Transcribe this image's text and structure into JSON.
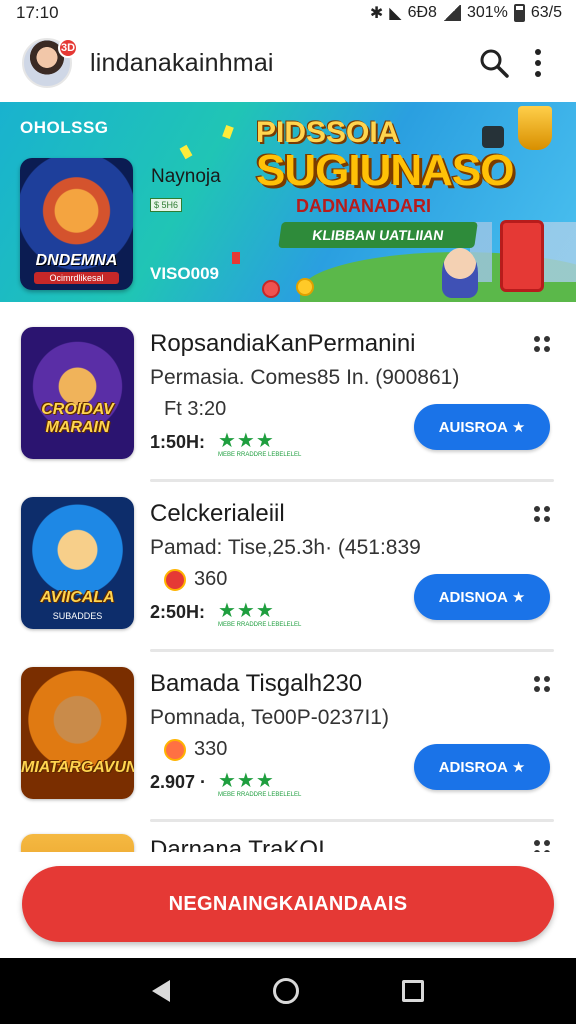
{
  "status_bar": {
    "time": "17:10",
    "network": "6Ð8",
    "battery_pct": "301%",
    "clock2": "63/5"
  },
  "header": {
    "avatar_badge": "3D",
    "title": "lindanakainhmai"
  },
  "banner": {
    "label": "OHOLSSG",
    "app_name": "Naynoja",
    "tag": "$ 5H6",
    "thumb_caption": "DNDEMNA",
    "thumb_sub": "Ocimrdlikesal",
    "code": "VISO009",
    "promo_title_line1": "PIDSSOIA",
    "promo_title_line2": "SUGIUNASO",
    "promo_subtitle": "DADNANADARI",
    "promo_ribbon": "KLIBBAN UATLIIAN"
  },
  "games": [
    {
      "title": "RopsandiaKanPermanini",
      "subtitle": "Permasia. Comes85 In. (900861)",
      "meta": "Ft 3:20",
      "time": "1:50H:",
      "stars": "★★★",
      "tiny": "MEBE RRADDRE LEBELELEL",
      "action_label": "AUISROA",
      "thumb_caption": "CROIDAV MARAIN",
      "thumb_caption2": ""
    },
    {
      "title": "Celckerialeiil",
      "subtitle": "Pamad: Tise,25.3h· (451:839",
      "meta": "360",
      "time": "2:50H:",
      "stars": "★★★",
      "tiny": "MEBE RRADDRE LEBELELEL",
      "action_label": "ADISNOA",
      "thumb_caption": "AVIICALA",
      "thumb_caption2": "SUBADDES"
    },
    {
      "title": "Bamada Tisgalh230",
      "subtitle": "Pomnada, Te00P-0237I1)",
      "meta": "330",
      "time": "2.907 ·",
      "stars": "★★★",
      "tiny": "MEBE RRADDRE LEBELELEL",
      "action_label": "ADISROA",
      "thumb_caption": "MIATARGAVUNG",
      "thumb_caption2": ""
    },
    {
      "title": "Darnana TraKOI"
    }
  ],
  "cta": {
    "label": "NEGNAINGKAIANDAAIS"
  },
  "colors": {
    "primary_blue": "#1a73e8",
    "cta_red": "#e53935",
    "star_green": "#1e9e3e",
    "banner_teal": "#20c5b5"
  }
}
